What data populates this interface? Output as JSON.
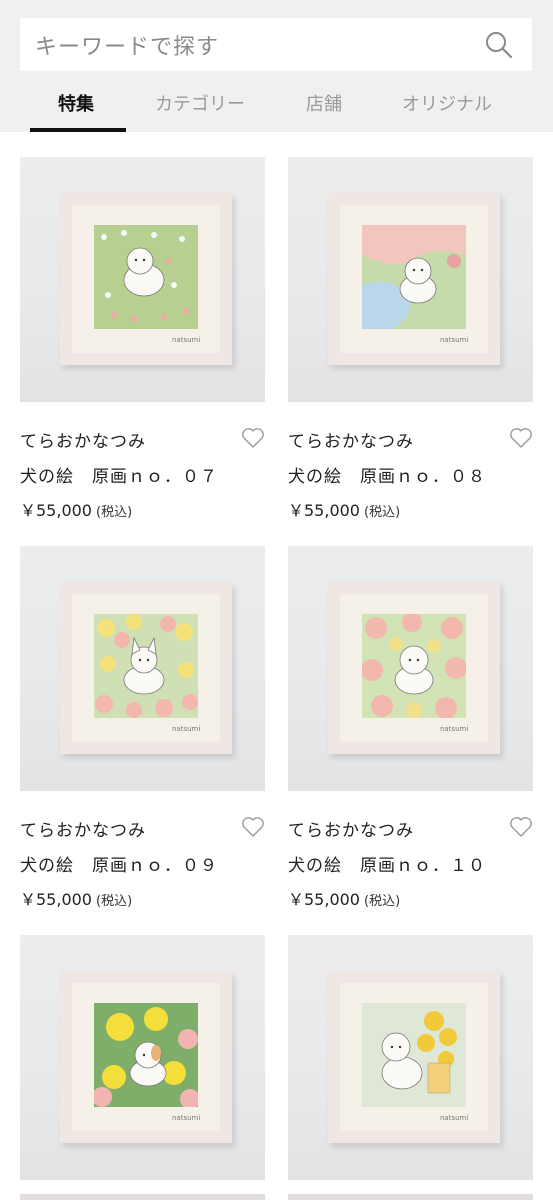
{
  "search": {
    "placeholder": "キーワードで探す",
    "icon": "search-icon"
  },
  "tabs": [
    {
      "label": "特集",
      "active": true
    },
    {
      "label": "カテゴリー",
      "active": false
    },
    {
      "label": "店舗",
      "active": false
    },
    {
      "label": "オリジナル",
      "active": false
    }
  ],
  "products": [
    {
      "artist": "てらおかなつみ",
      "name": "犬の絵　原画ｎｏ．０７",
      "price": "￥55,000",
      "tax": "(税込)"
    },
    {
      "artist": "てらおかなつみ",
      "name": "犬の絵　原画ｎｏ．０８",
      "price": "￥55,000",
      "tax": "(税込)"
    },
    {
      "artist": "てらおかなつみ",
      "name": "犬の絵　原画ｎｏ．０９",
      "price": "￥55,000",
      "tax": "(税込)"
    },
    {
      "artist": "てらおかなつみ",
      "name": "犬の絵　原画ｎｏ．１０",
      "price": "￥55,000",
      "tax": "(税込)"
    },
    {
      "artist": "",
      "name": "",
      "price": "",
      "tax": ""
    },
    {
      "artist": "",
      "name": "",
      "price": "",
      "tax": ""
    }
  ]
}
